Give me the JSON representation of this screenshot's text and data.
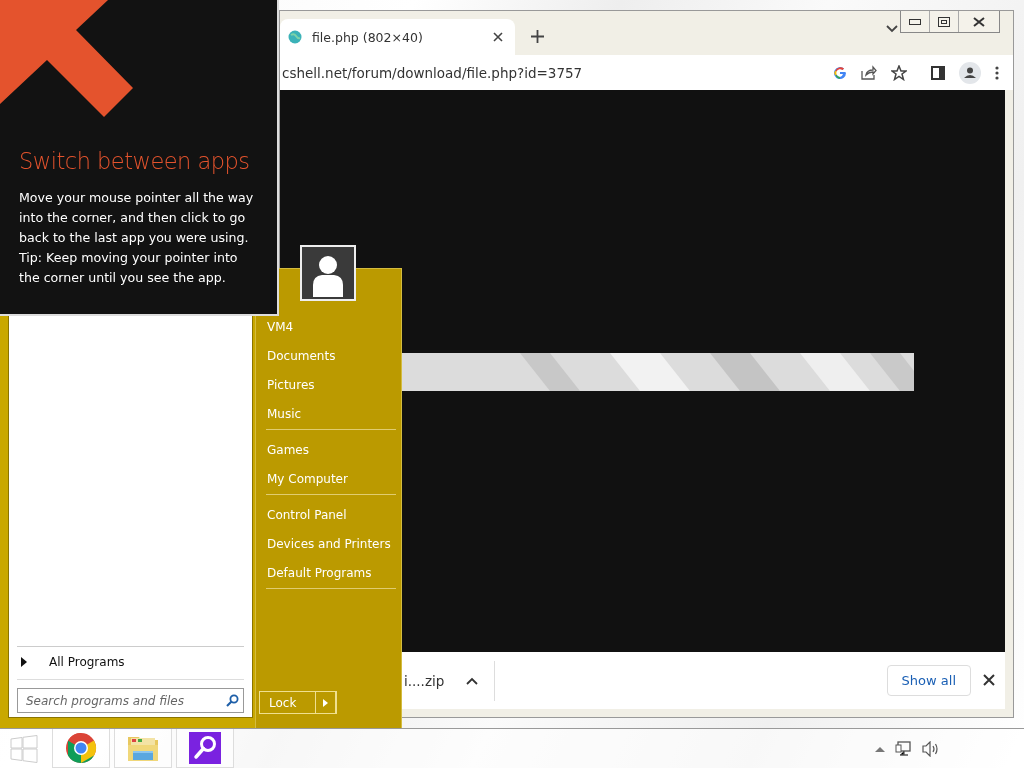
{
  "tip": {
    "title": "Switch between apps",
    "body": [
      "Move your mouse pointer all the way into the corner, and then click to go back to the last app you were using.",
      "Tip: Keep moving your pointer into the corner until you see the app."
    ]
  },
  "browser": {
    "tab": {
      "title": "file.php (802×40)"
    },
    "address": "cshell.net/forum/download/file.php?id=3757",
    "download_bar": {
      "item": "i....zip",
      "button": "Show all"
    }
  },
  "start_menu": {
    "groups": [
      {
        "items": [
          "VM4",
          "Documents",
          "Pictures",
          "Music"
        ]
      },
      {
        "items": [
          "Games",
          "My Computer"
        ]
      },
      {
        "items": [
          "Control Panel",
          "Devices and Printers",
          "Default Programs"
        ]
      }
    ],
    "all_programs": "All Programs",
    "search": {
      "placeholder": "Search programs and files"
    },
    "lock_button": "Lock"
  },
  "taskbar": {
    "apps": [
      {
        "kind": "chrome"
      },
      {
        "kind": "folder"
      },
      {
        "kind": "search"
      }
    ]
  }
}
